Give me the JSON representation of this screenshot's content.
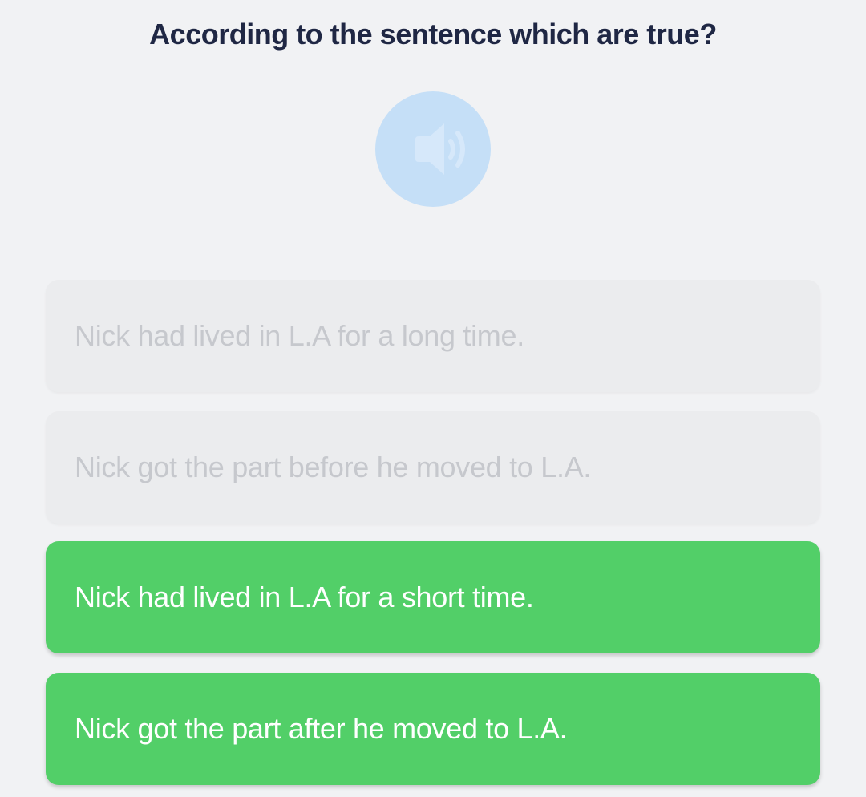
{
  "question": "According to the sentence which are true?",
  "audio": {
    "icon": "speaker-icon",
    "color": "#c5dff7"
  },
  "options": [
    {
      "text": "Nick had lived in L.A for a long time.",
      "state": "disabled"
    },
    {
      "text": "Nick got the part before he moved to L.A.",
      "state": "disabled"
    },
    {
      "text": "Nick had lived in L.A for a short time.",
      "state": "correct"
    },
    {
      "text": "Nick got the part after he moved to L.A.",
      "state": "correct"
    }
  ],
  "colors": {
    "background": "#f1f2f4",
    "question_text": "#1f2744",
    "correct": "#52cf68",
    "disabled_bg": "#ebecee",
    "disabled_text": "#c6c8cd"
  }
}
